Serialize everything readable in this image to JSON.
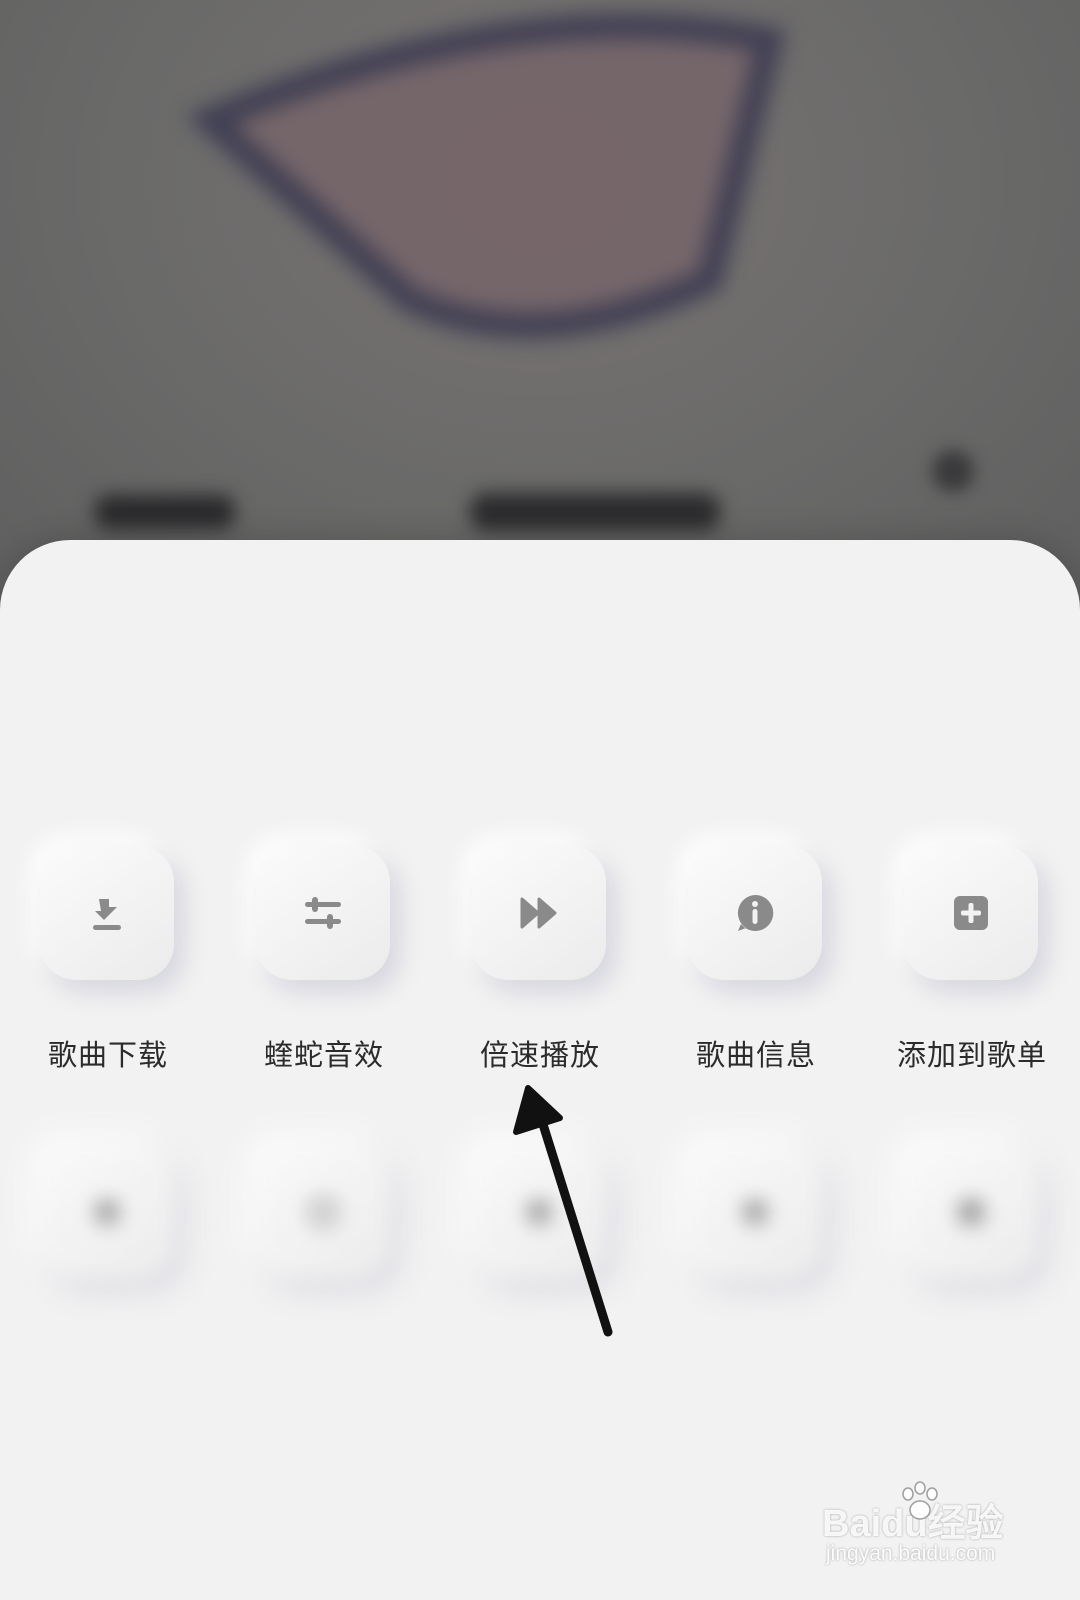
{
  "now_playing": {
    "title": "",
    "subtitle": ""
  },
  "actions_primary": [
    {
      "label": "歌曲下载",
      "icon": "download-icon"
    },
    {
      "label": "蝰蛇音效",
      "icon": "equalizer-icon"
    },
    {
      "label": "倍速播放",
      "icon": "fast-forward-icon"
    },
    {
      "label": "歌曲信息",
      "icon": "info-icon"
    },
    {
      "label": "添加到歌单",
      "icon": "add-to-playlist-icon"
    }
  ],
  "actions_secondary": [
    {
      "label": "",
      "icon": "menu-icon-1"
    },
    {
      "label": "",
      "sublabel": "",
      "icon": "menu-icon-2"
    },
    {
      "label": "",
      "icon": "menu-icon-3"
    },
    {
      "label": "",
      "icon": "menu-icon-4"
    },
    {
      "label": "",
      "icon": "menu-icon-5"
    }
  ],
  "watermark": {
    "brand": "Baidu经验",
    "url": "jingyan.baidu.com"
  },
  "colors": {
    "sheet_bg": "#f2f2f2",
    "icon_gray": "#8a8a8a",
    "label_text": "#2b2b2b",
    "annotation_arrow": "#111111"
  }
}
